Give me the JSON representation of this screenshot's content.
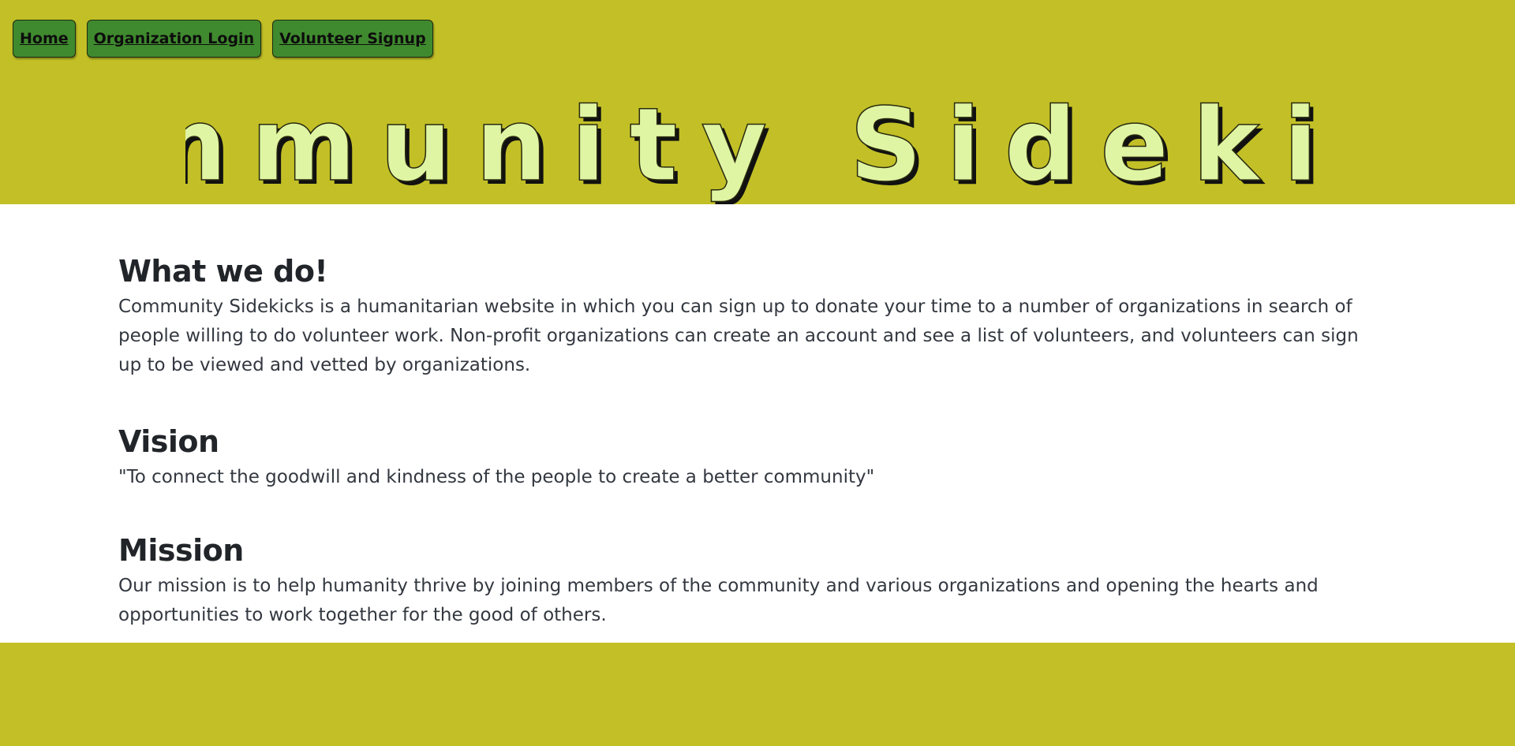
{
  "nav": {
    "home_label": "Home",
    "org_login_label": "Organization Login",
    "volunteer_signup_label": "Volunteer Signup"
  },
  "header": {
    "logo_text": "Community Sidekicks"
  },
  "colors": {
    "header_bg": "#c2c026",
    "nav_button_bg": "#3f8a2e",
    "logo_fill": "#dff5a3",
    "body_bg": "#ffffff"
  },
  "sections": {
    "what_we_do": {
      "title": "What we do!",
      "text": "Community Sidekicks is a humanitarian website in which you can sign up to donate your time to a number of organizations in search of people willing to do volunteer work. Non-profit organizations can create an account and see a list of volunteers, and volunteers can sign up to be viewed and vetted by organizations."
    },
    "vision": {
      "title": "Vision",
      "text": "\"To connect the goodwill and kindness of the people to create a better community\""
    },
    "mission": {
      "title": "Mission",
      "text": "Our mission is to help humanity thrive by joining members of the community and various organizations and opening the hearts and opportunities to work together for the good of others."
    }
  }
}
